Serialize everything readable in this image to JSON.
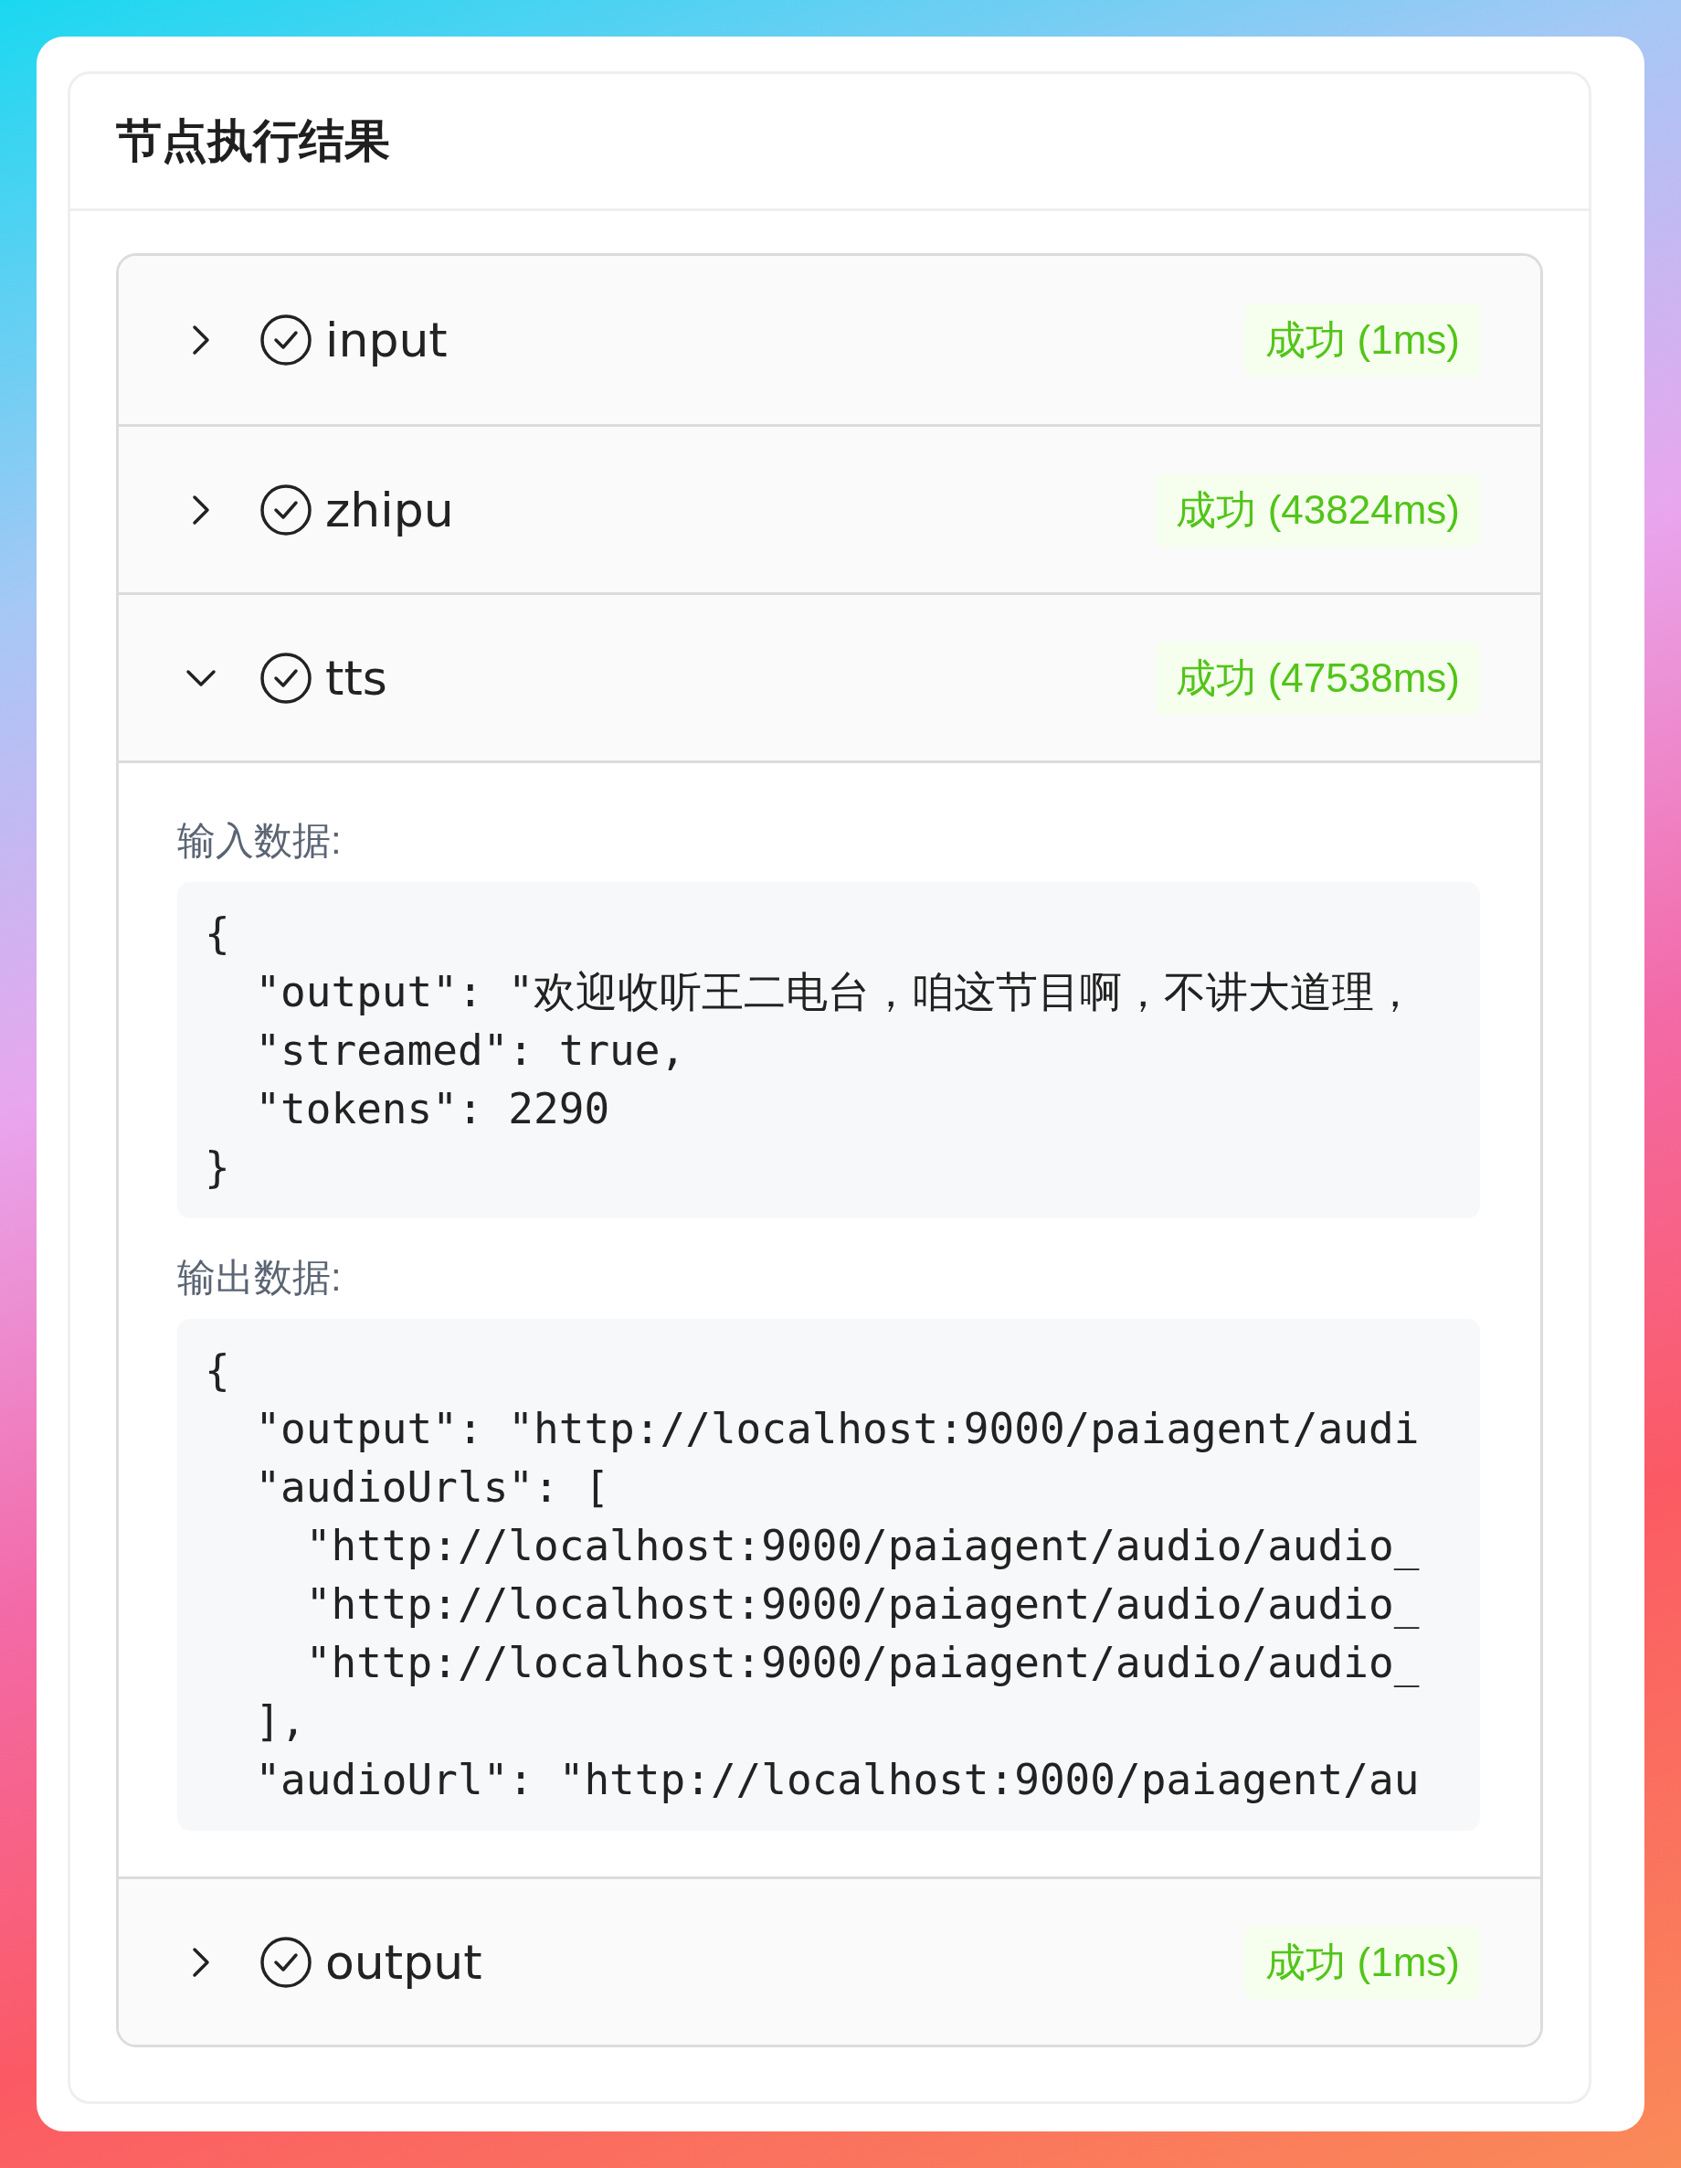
{
  "panel": {
    "title": "节点执行结果"
  },
  "nodes": [
    {
      "name": "input",
      "status_text": "成功 (1ms)",
      "expanded": false
    },
    {
      "name": "zhipu",
      "status_text": "成功 (43824ms)",
      "expanded": false
    },
    {
      "name": "tts",
      "status_text": "成功 (47538ms)",
      "expanded": true,
      "sections": [
        {
          "label": "输入数据:",
          "lines": [
            "{",
            "  \"output\": \"欢迎收听王二电台，咱这节目啊，不讲大道理，",
            "  \"streamed\": true,",
            "  \"tokens\": 2290",
            "}"
          ]
        },
        {
          "label": "输出数据:",
          "lines": [
            "{",
            "  \"output\": \"http://localhost:9000/paiagent/audi",
            "  \"audioUrls\": [",
            "    \"http://localhost:9000/paiagent/audio/audio_",
            "    \"http://localhost:9000/paiagent/audio/audio_",
            "    \"http://localhost:9000/paiagent/audio/audio_",
            "  ],",
            "  \"audioUrl\": \"http://localhost:9000/paiagent/au"
          ]
        }
      ]
    },
    {
      "name": "output",
      "status_text": "成功 (1ms)",
      "expanded": false
    }
  ]
}
